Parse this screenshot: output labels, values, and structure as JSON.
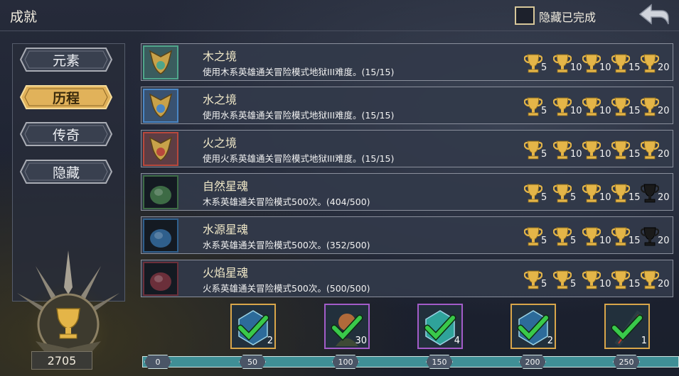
{
  "header": {
    "title": "成就",
    "hide_completed_label": "隐藏已完成"
  },
  "sidebar": {
    "tabs": [
      {
        "label": "元素",
        "active": false
      },
      {
        "label": "历程",
        "active": true
      },
      {
        "label": "传奇",
        "active": false
      },
      {
        "label": "隐藏",
        "active": false
      }
    ]
  },
  "achievements": [
    {
      "title": "木之境",
      "desc": "使用木系英雄通关冒险模式地狱III难度。(15/15)",
      "icon": "wood-crest-icon",
      "frame_color": "#4fa58a",
      "trophies": [
        {
          "pts": "5",
          "earned": true
        },
        {
          "pts": "10",
          "earned": true
        },
        {
          "pts": "10",
          "earned": true
        },
        {
          "pts": "15",
          "earned": true
        },
        {
          "pts": "20",
          "earned": true
        }
      ]
    },
    {
      "title": "水之境",
      "desc": "使用水系英雄通关冒险模式地狱III难度。(15/15)",
      "icon": "water-crest-icon",
      "frame_color": "#4a86c4",
      "trophies": [
        {
          "pts": "5",
          "earned": true
        },
        {
          "pts": "10",
          "earned": true
        },
        {
          "pts": "10",
          "earned": true
        },
        {
          "pts": "15",
          "earned": true
        },
        {
          "pts": "20",
          "earned": true
        }
      ]
    },
    {
      "title": "火之境",
      "desc": "使用火系英雄通关冒险模式地狱III难度。(15/15)",
      "icon": "fire-crest-icon",
      "frame_color": "#b8483c",
      "trophies": [
        {
          "pts": "5",
          "earned": true
        },
        {
          "pts": "10",
          "earned": true
        },
        {
          "pts": "10",
          "earned": true
        },
        {
          "pts": "15",
          "earned": true
        },
        {
          "pts": "20",
          "earned": true
        }
      ]
    },
    {
      "title": "自然星魂",
      "desc": "木系英雄通关冒险模式500次。(404/500)",
      "icon": "nature-soul-icon",
      "frame_color": "#3d6b45",
      "trophies": [
        {
          "pts": "5",
          "earned": true
        },
        {
          "pts": "5",
          "earned": true
        },
        {
          "pts": "10",
          "earned": true
        },
        {
          "pts": "15",
          "earned": true
        },
        {
          "pts": "20",
          "earned": false
        }
      ]
    },
    {
      "title": "水源星魂",
      "desc": "水系英雄通关冒险模式500次。(352/500)",
      "icon": "water-soul-icon",
      "frame_color": "#2f5f8c",
      "trophies": [
        {
          "pts": "5",
          "earned": true
        },
        {
          "pts": "5",
          "earned": true
        },
        {
          "pts": "10",
          "earned": true
        },
        {
          "pts": "15",
          "earned": true
        },
        {
          "pts": "20",
          "earned": false
        }
      ]
    },
    {
      "title": "火焰星魂",
      "desc": "火系英雄通关冒险模式500次。(500/500)",
      "icon": "fire-soul-icon",
      "frame_color": "#6b2f3a",
      "trophies": [
        {
          "pts": "5",
          "earned": true
        },
        {
          "pts": "5",
          "earned": true
        },
        {
          "pts": "10",
          "earned": true
        },
        {
          "pts": "15",
          "earned": true
        },
        {
          "pts": "20",
          "earned": true
        }
      ]
    }
  ],
  "score": {
    "total": "2705"
  },
  "milestones": [
    "0",
    "50",
    "100",
    "150",
    "200",
    "250"
  ],
  "rewards": [
    {
      "count": "2",
      "icon": "blue-crystal-icon",
      "frame_color": "#d9a64a"
    },
    {
      "count": "30",
      "icon": "hero-portrait-icon",
      "frame_color": "#a35cc9"
    },
    {
      "count": "4",
      "icon": "teal-crystal-icon",
      "frame_color": "#a35cc9"
    },
    {
      "count": "2",
      "icon": "blue-crystal-icon",
      "frame_color": "#d9a64a"
    },
    {
      "count": "1",
      "icon": "dark-sword-icon",
      "frame_color": "#d9a64a"
    }
  ],
  "colors": {
    "gold": "#e4b548",
    "bar": "#3f8f96",
    "check": "#39c94a"
  }
}
